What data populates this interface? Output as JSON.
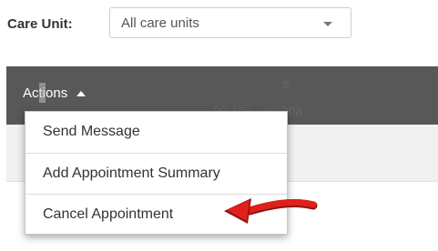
{
  "filter": {
    "label": "Care Unit:",
    "selected_value": "All care units",
    "caret_icon": "chevron-down-icon"
  },
  "header": {
    "actions_label": "Actions",
    "toggle_icon": "caret-up-icon",
    "background_color": "#585858"
  },
  "actions_menu": {
    "items": [
      {
        "label": "Send Message"
      },
      {
        "label": "Add Appointment Summary"
      },
      {
        "label": "Cancel Appointment"
      }
    ]
  },
  "table": {
    "partial_text": "e",
    "partial_time": "09:10a - 09:30a"
  },
  "annotation": {
    "icon": "red-arrow-icon",
    "color": "#e0201b"
  }
}
